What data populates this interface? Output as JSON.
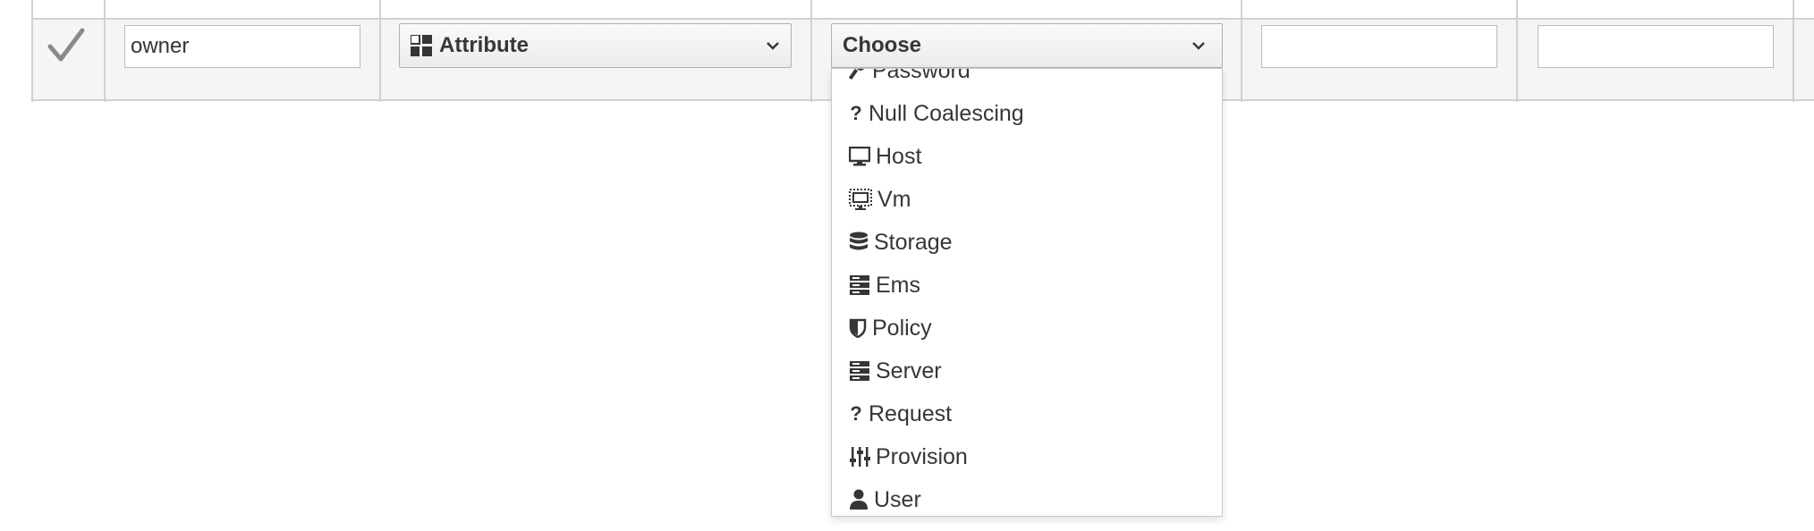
{
  "row": {
    "name_value": "owner",
    "type_select_label": "Attribute",
    "value_select_label": "Choose"
  },
  "dropdown": {
    "items": [
      {
        "label": "Password",
        "icon": "key-icon"
      },
      {
        "label": "Null Coalescing",
        "icon": "question-icon"
      },
      {
        "label": "Host",
        "icon": "desktop-icon"
      },
      {
        "label": "Vm",
        "icon": "virtual-machine-icon"
      },
      {
        "label": "Storage",
        "icon": "database-icon"
      },
      {
        "label": "Ems",
        "icon": "server-stack-icon"
      },
      {
        "label": "Policy",
        "icon": "shield-icon"
      },
      {
        "label": "Server",
        "icon": "server-stack-icon"
      },
      {
        "label": "Request",
        "icon": "question-icon"
      },
      {
        "label": "Provision",
        "icon": "sliders-icon"
      },
      {
        "label": "User",
        "icon": "user-icon"
      }
    ]
  },
  "colors": {
    "text": "#363636",
    "row_bg": "#f5f5f5",
    "border": "#d1d1d1"
  }
}
